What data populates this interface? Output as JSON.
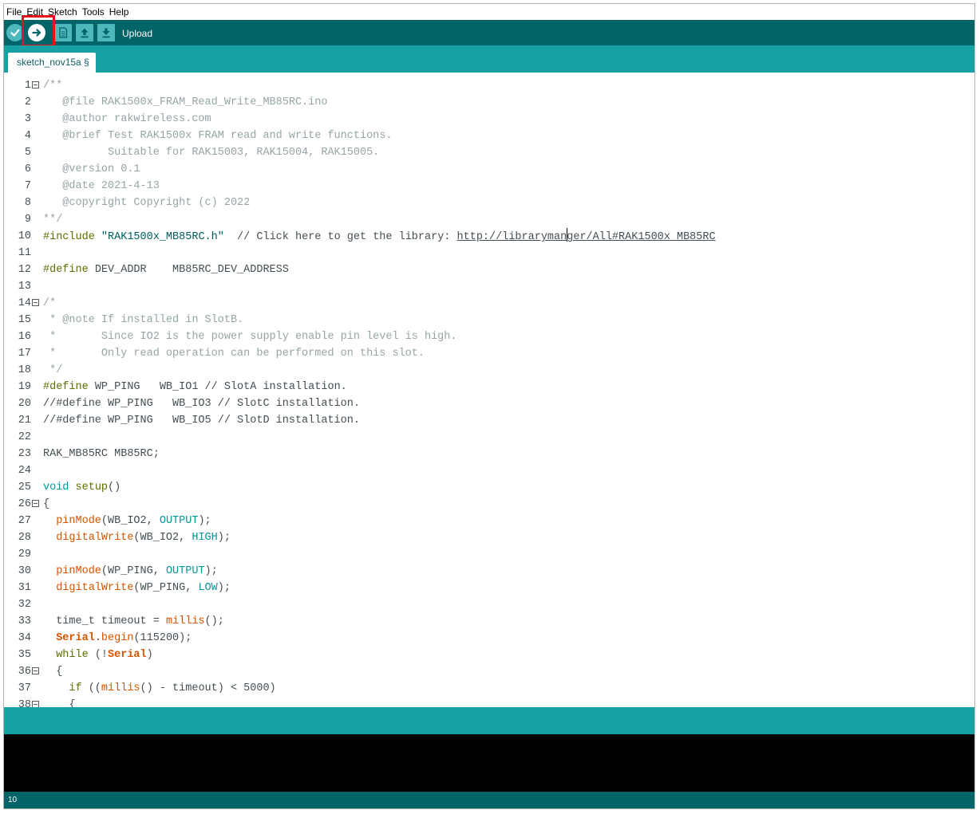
{
  "menu": [
    "File",
    "Edit",
    "Sketch",
    "Tools",
    "Help"
  ],
  "toolbar": {
    "hover_label": "Upload",
    "buttons": [
      "verify-icon",
      "upload-icon",
      "new-icon",
      "open-icon",
      "save-icon"
    ]
  },
  "tab": {
    "label": "sketch_nov15a §"
  },
  "colors": {
    "toolbar": "#006468",
    "tabstrip": "#17a1a5",
    "highlight": "#e8111f",
    "comment": "#95a5a6",
    "keyword": "#00979c",
    "function": "#d35400"
  },
  "editor": {
    "lines": [
      {
        "n": "1",
        "fold": true,
        "segs": [
          [
            "c",
            "/**"
          ]
        ]
      },
      {
        "n": "2",
        "segs": [
          [
            "c",
            "   @file RAK1500x_FRAM_Read_Write_MB85RC.ino"
          ]
        ]
      },
      {
        "n": "3",
        "segs": [
          [
            "c",
            "   @author rakwireless.com"
          ]
        ]
      },
      {
        "n": "4",
        "segs": [
          [
            "c",
            "   @brief Test RAK1500x FRAM read and write functions."
          ]
        ]
      },
      {
        "n": "5",
        "segs": [
          [
            "c",
            "          Suitable for RAK15003, RAK15004, RAK15005."
          ]
        ]
      },
      {
        "n": "6",
        "segs": [
          [
            "c",
            "   @version 0.1"
          ]
        ]
      },
      {
        "n": "7",
        "segs": [
          [
            "c",
            "   @date 2021-4-13"
          ]
        ]
      },
      {
        "n": "8",
        "segs": [
          [
            "c",
            "   @copyright Copyright (c) 2022"
          ]
        ]
      },
      {
        "n": "9",
        "segs": [
          [
            "c",
            "**/"
          ]
        ]
      },
      {
        "n": "10",
        "segs": [
          [
            "p",
            "#include"
          ],
          [
            "t",
            " "
          ],
          [
            "s",
            "\"RAK1500x_MB85RC.h\""
          ],
          [
            "t",
            "  // Click here to get the library: "
          ],
          [
            "l",
            "http://libraryman"
          ],
          [
            "caret",
            ""
          ],
          [
            "l",
            "ger/All#RAK1500x_MB85RC"
          ]
        ]
      },
      {
        "n": "11",
        "segs": []
      },
      {
        "n": "12",
        "segs": [
          [
            "p",
            "#define"
          ],
          [
            "t",
            " DEV_ADDR    MB85RC_DEV_ADDRESS"
          ]
        ]
      },
      {
        "n": "13",
        "segs": []
      },
      {
        "n": "14",
        "fold": true,
        "segs": [
          [
            "c",
            "/*"
          ]
        ]
      },
      {
        "n": "15",
        "segs": [
          [
            "c",
            " * @note If installed in SlotB."
          ]
        ]
      },
      {
        "n": "16",
        "segs": [
          [
            "c",
            " *       Since IO2 is the power supply enable pin level is high."
          ]
        ]
      },
      {
        "n": "17",
        "segs": [
          [
            "c",
            " *       Only read operation can be performed on this slot."
          ]
        ]
      },
      {
        "n": "18",
        "segs": [
          [
            "c",
            " */"
          ]
        ]
      },
      {
        "n": "19",
        "segs": [
          [
            "p",
            "#define"
          ],
          [
            "t",
            " WP_PING   WB_IO1 // SlotA installation."
          ]
        ]
      },
      {
        "n": "20",
        "segs": [
          [
            "t",
            "//#define WP_PING   WB_IO3 // SlotC installation."
          ]
        ]
      },
      {
        "n": "21",
        "segs": [
          [
            "t",
            "//#define WP_PING   WB_IO5 // SlotD installation."
          ]
        ]
      },
      {
        "n": "22",
        "segs": []
      },
      {
        "n": "23",
        "segs": [
          [
            "t",
            "RAK_MB85RC MB85RC;"
          ]
        ]
      },
      {
        "n": "24",
        "segs": []
      },
      {
        "n": "25",
        "segs": [
          [
            "k",
            "void"
          ],
          [
            "t",
            " "
          ],
          [
            "p",
            "setup"
          ],
          [
            "t",
            "()"
          ]
        ]
      },
      {
        "n": "26",
        "fold": true,
        "segs": [
          [
            "t",
            "{"
          ]
        ]
      },
      {
        "n": "27",
        "segs": [
          [
            "t",
            "  "
          ],
          [
            "f",
            "pinMode"
          ],
          [
            "t",
            "(WB_IO2, "
          ],
          [
            "k",
            "OUTPUT"
          ],
          [
            "t",
            ");"
          ]
        ]
      },
      {
        "n": "28",
        "segs": [
          [
            "t",
            "  "
          ],
          [
            "f",
            "digitalWrite"
          ],
          [
            "t",
            "(WB_IO2, "
          ],
          [
            "k",
            "HIGH"
          ],
          [
            "t",
            ");"
          ]
        ]
      },
      {
        "n": "29",
        "segs": []
      },
      {
        "n": "30",
        "segs": [
          [
            "t",
            "  "
          ],
          [
            "f",
            "pinMode"
          ],
          [
            "t",
            "(WP_PING, "
          ],
          [
            "k",
            "OUTPUT"
          ],
          [
            "t",
            ");"
          ]
        ]
      },
      {
        "n": "31",
        "segs": [
          [
            "t",
            "  "
          ],
          [
            "f",
            "digitalWrite"
          ],
          [
            "t",
            "(WP_PING, "
          ],
          [
            "k",
            "LOW"
          ],
          [
            "t",
            ");"
          ]
        ]
      },
      {
        "n": "32",
        "segs": []
      },
      {
        "n": "33",
        "segs": [
          [
            "t",
            "  time_t timeout = "
          ],
          [
            "f",
            "millis"
          ],
          [
            "t",
            "();"
          ]
        ]
      },
      {
        "n": "34",
        "segs": [
          [
            "t",
            "  "
          ],
          [
            "fb",
            "Serial"
          ],
          [
            "t",
            "."
          ],
          [
            "f",
            "begin"
          ],
          [
            "t",
            "(115200);"
          ]
        ]
      },
      {
        "n": "35",
        "segs": [
          [
            "t",
            "  "
          ],
          [
            "p",
            "while"
          ],
          [
            "t",
            " (!"
          ],
          [
            "fb",
            "Serial"
          ],
          [
            "t",
            ")"
          ]
        ]
      },
      {
        "n": "36",
        "fold": true,
        "segs": [
          [
            "t",
            "  {"
          ]
        ]
      },
      {
        "n": "37",
        "segs": [
          [
            "t",
            "    "
          ],
          [
            "p",
            "if"
          ],
          [
            "t",
            " (("
          ],
          [
            "f",
            "millis"
          ],
          [
            "t",
            "() - timeout) < 5000)"
          ]
        ]
      },
      {
        "n": "38",
        "fold": true,
        "segs": [
          [
            "t",
            "    {"
          ]
        ]
      }
    ]
  },
  "status": {
    "line_indicator": "10"
  }
}
